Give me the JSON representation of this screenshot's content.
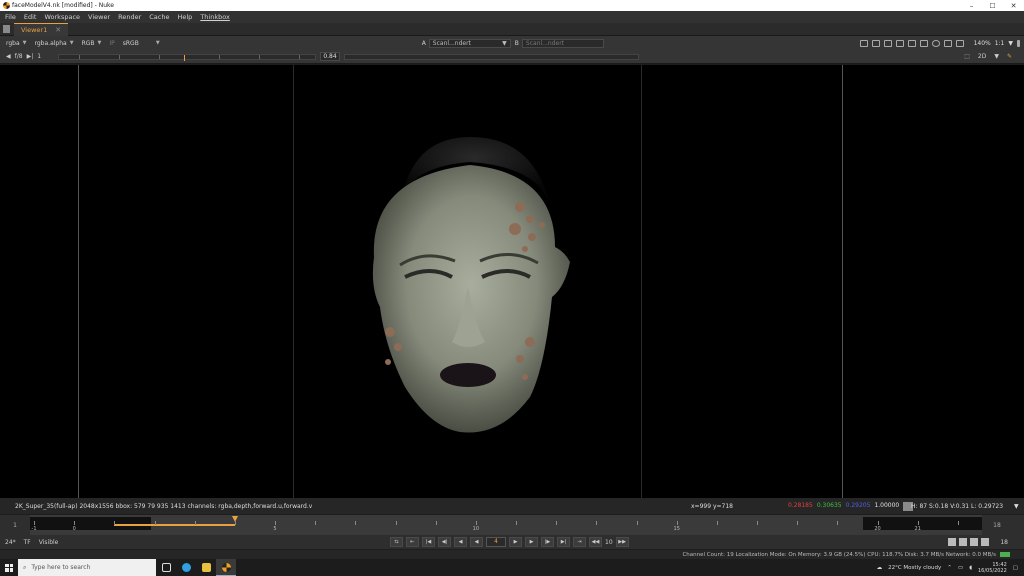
{
  "window": {
    "title": "faceModelV4.nk [modified] - Nuke",
    "controls": [
      "–",
      "☐",
      "✕"
    ]
  },
  "menu": [
    "File",
    "Edit",
    "Workspace",
    "Viewer",
    "Render",
    "Cache",
    "Help",
    "Thinkbox"
  ],
  "tabs": [
    {
      "label": "Viewer1",
      "close": "✕"
    }
  ],
  "viewer_controls": {
    "layer": "rgba",
    "channel": "rgba.alpha",
    "display": "RGB",
    "ip_label": "IP",
    "colorspace": "sRGB",
    "input_a_label": "A",
    "input_a": "Scanl...ndert",
    "input_b_label": "B",
    "input_b": "Scanl...ndert",
    "zoom": "140%",
    "ratio": "1:1",
    "fstop": "f/8",
    "frame_step": "1",
    "gain": "0.84",
    "view_mode": "2D"
  },
  "info": {
    "format": "2K_Super_35(full-ap) 2048x1556  bbox: 579 79 935 1413 channels: rgba,depth,forward.u,forward.v",
    "coords": "x=999 y=718",
    "r": "0.28185",
    "g": "0.30635",
    "b": "0.29205",
    "a": "1.00000",
    "hsv": "H: 87 S:0.18 V:0.31  L: 0.29723",
    "colors": {
      "r": "#e04040",
      "g": "#40c040",
      "b": "#5060e0",
      "a": "#e0e0e0"
    }
  },
  "timeline": {
    "in_point": "1",
    "out_point": "18",
    "tick_labels": [
      {
        "label": "-1",
        "pos": -1
      },
      {
        "label": "0",
        "pos": 0
      },
      {
        "label": "5",
        "pos": 5
      },
      {
        "label": "10",
        "pos": 10
      },
      {
        "label": "15",
        "pos": 15
      },
      {
        "label": "20",
        "pos": 20
      },
      {
        "label": "21",
        "pos": 21
      }
    ],
    "current_frame": 4
  },
  "playback": {
    "fps": "24*",
    "tf": "TF",
    "visible": "Visible",
    "current_frame": "4",
    "step": "10",
    "end_frame": "18"
  },
  "status": "Channel Count: 19  Localization Mode: On  Memory: 3.9 GB (24.5%)  CPU: 118.7%  Disk: 3.7 MB/s  Network: 0.0 MB/s",
  "taskbar": {
    "search_placeholder": "Type here to search",
    "weather": "22°C  Mostly cloudy",
    "time": "15:42",
    "date": "16/05/2022"
  }
}
